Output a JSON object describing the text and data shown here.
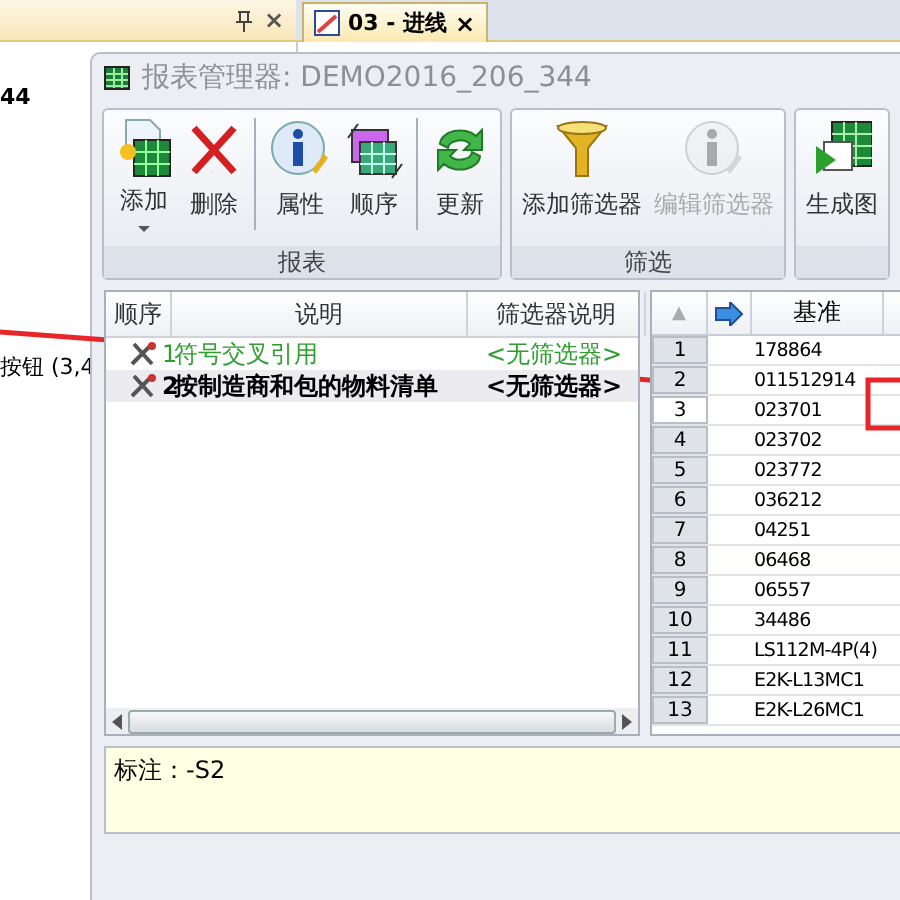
{
  "side_panel": {
    "lines": [
      "44",
      "按钮 (3,4"
    ],
    "close": "×"
  },
  "document_tab": {
    "label": "03 - 进线",
    "close": "×",
    "selected": true
  },
  "dialog": {
    "title": "报表管理器: DEMO2016_206_344"
  },
  "ribbon": {
    "groups": [
      {
        "label": "报表",
        "sections": [
          [
            {
              "label": "添加",
              "kind": "add",
              "disabled": false,
              "dropdown": true
            },
            {
              "label": "删除",
              "kind": "delete",
              "disabled": false,
              "dropdown": false
            }
          ],
          [
            {
              "label": "属性",
              "kind": "info",
              "disabled": false,
              "dropdown": false
            },
            {
              "label": "顺序",
              "kind": "order",
              "disabled": false,
              "dropdown": false
            }
          ],
          [
            {
              "label": "更新",
              "kind": "refresh",
              "disabled": false,
              "dropdown": false
            }
          ]
        ]
      },
      {
        "label": "筛选",
        "sections": [
          [
            {
              "label": "添加筛选器",
              "kind": "funnel",
              "disabled": false,
              "dropdown": false
            },
            {
              "label": "编辑筛选器",
              "kind": "info",
              "disabled": true,
              "dropdown": false
            }
          ]
        ]
      },
      {
        "sections": [
          [
            {
              "label": "生成图",
              "kind": "generate",
              "disabled": false,
              "dropdown": false
            }
          ]
        ]
      }
    ]
  },
  "report_list": {
    "columns": [
      "顺序",
      "说明",
      "筛选器说明"
    ],
    "rows": [
      {
        "order": "1",
        "description": "符号交叉引用",
        "filter": "<无筛选器>",
        "color": "#2e9e2e",
        "selected": false
      },
      {
        "order": "2",
        "description": "按制造商和包的物料清单",
        "filter": "<无筛选器>",
        "color": "#000000",
        "selected": true
      }
    ]
  },
  "grid": {
    "sort": "▲",
    "columns": [
      "基准"
    ],
    "rows": [
      {
        "index": "1",
        "value": "178864",
        "selected": false
      },
      {
        "index": "2",
        "value": "011512914",
        "selected": false
      },
      {
        "index": "3",
        "value": "023701",
        "selected": true
      },
      {
        "index": "4",
        "value": "023702",
        "selected": false
      },
      {
        "index": "5",
        "value": "023772",
        "selected": false
      },
      {
        "index": "6",
        "value": "036212",
        "selected": false
      },
      {
        "index": "7",
        "value": "04251",
        "selected": false
      },
      {
        "index": "8",
        "value": "06468",
        "selected": false
      },
      {
        "index": "9",
        "value": "06557",
        "selected": false
      },
      {
        "index": "10",
        "value": "34486",
        "selected": false
      },
      {
        "index": "11",
        "value": "LS112M-4P(4)",
        "selected": false
      },
      {
        "index": "12",
        "value": "E2K-L13MC1",
        "selected": false
      },
      {
        "index": "13",
        "value": "E2K-L26MC1",
        "selected": false
      }
    ]
  },
  "note": {
    "text": "标注：-S2"
  }
}
